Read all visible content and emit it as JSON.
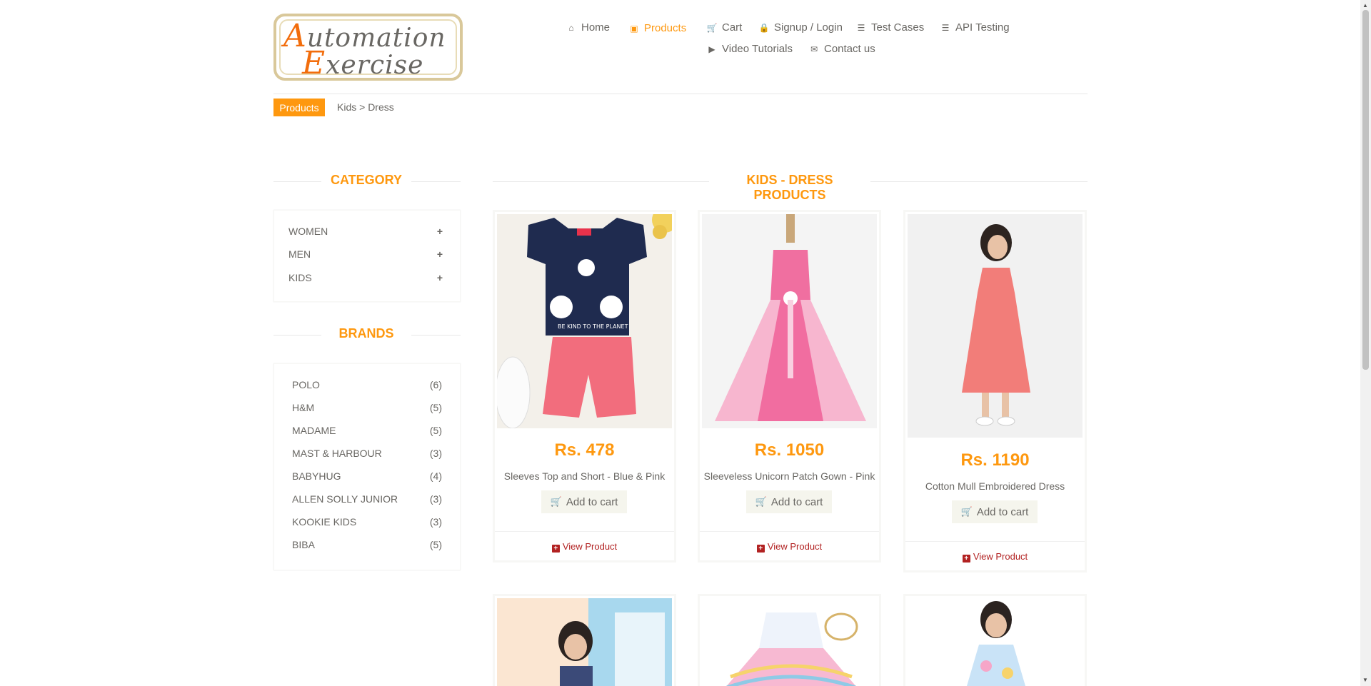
{
  "logo": {
    "line1_cap": "A",
    "line1_rest": "utomation",
    "line2_cap": "E",
    "line2_rest": "xercise"
  },
  "nav": [
    {
      "label": "Home",
      "icon": "home-icon",
      "glyph": "⌂"
    },
    {
      "label": "Products",
      "icon": "briefcase-icon",
      "glyph": "▣"
    },
    {
      "label": "Cart",
      "icon": "cart-icon",
      "glyph": "🛒"
    },
    {
      "label": "Signup / Login",
      "icon": "lock-icon",
      "glyph": "🔒"
    },
    {
      "label": "Test Cases",
      "icon": "list-icon",
      "glyph": "☰"
    },
    {
      "label": "API Testing",
      "icon": "list-icon",
      "glyph": "☰"
    },
    {
      "label": "Video Tutorials",
      "icon": "youtube-icon",
      "glyph": "▶"
    },
    {
      "label": "Contact us",
      "icon": "envelope-icon",
      "glyph": "✉"
    }
  ],
  "breadcrumb": {
    "badge": "Products",
    "path": "Kids > Dress"
  },
  "sidebar": {
    "category_title": "CATEGORY",
    "categories": [
      {
        "label": "WOMEN",
        "toggle": "+"
      },
      {
        "label": "MEN",
        "toggle": "+"
      },
      {
        "label": "KIDS",
        "toggle": "+"
      }
    ],
    "brands_title": "BRANDS",
    "brands": [
      {
        "name": "POLO",
        "count": "(6)"
      },
      {
        "name": "H&M",
        "count": "(5)"
      },
      {
        "name": "MADAME",
        "count": "(5)"
      },
      {
        "name": "MAST & HARBOUR",
        "count": "(3)"
      },
      {
        "name": "BABYHUG",
        "count": "(4)"
      },
      {
        "name": "ALLEN SOLLY JUNIOR",
        "count": "(3)"
      },
      {
        "name": "KOOKIE KIDS",
        "count": "(3)"
      },
      {
        "name": "BIBA",
        "count": "(5)"
      }
    ]
  },
  "main": {
    "title": "KIDS - DRESS PRODUCTS",
    "add_to_cart": "Add to cart",
    "view_product": "View Product",
    "products": [
      {
        "price": "Rs. 478",
        "name": "Sleeves Top and Short - Blue & Pink"
      },
      {
        "price": "Rs. 1050",
        "name": "Sleeveless Unicorn Patch Gown - Pink"
      },
      {
        "price": "Rs. 1190",
        "name": "Cotton Mull Embroidered Dress"
      }
    ]
  },
  "colors": {
    "accent": "#fe980f",
    "text": "#696763",
    "view_link": "#b22222"
  }
}
